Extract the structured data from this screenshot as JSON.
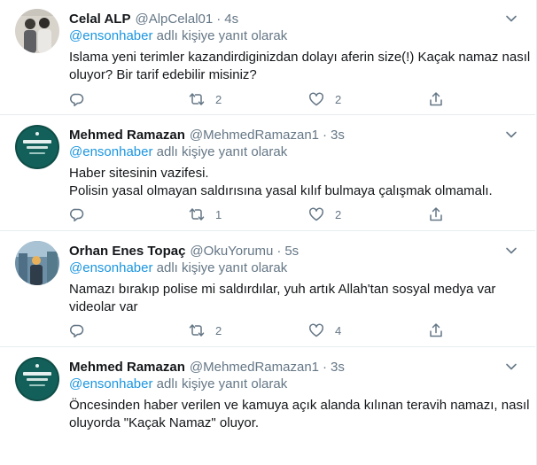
{
  "tweets": [
    {
      "name": "Celal ALP",
      "handle": "@AlpCelal01",
      "time": "4s",
      "reply_prefix": "@ensonhaber",
      "reply_suffix": "adlı kişiye yanıt olarak",
      "lines": [
        "Islama yeni terimler kazandirdiginizdan dolayı aferin size(!) Kaçak namaz nasıl",
        "oluyor? Bir tarif edebilir misiniz?"
      ],
      "reply_count": "",
      "retweet_count": "2",
      "like_count": "2"
    },
    {
      "name": "Mehmed Ramazan",
      "handle": "@MehmedRamazan1",
      "time": "3s",
      "reply_prefix": "@ensonhaber",
      "reply_suffix": "adlı kişiye yanıt olarak",
      "lines": [
        "Haber sitesinin vazifesi.",
        "Polisin yasal olmayan saldırısına yasal kılıf bulmaya çalışmak olmamalı."
      ],
      "reply_count": "",
      "retweet_count": "1",
      "like_count": "2"
    },
    {
      "name": "Orhan Enes Topaç",
      "handle": "@OkuYorumu",
      "time": "5s",
      "reply_prefix": "@ensonhaber",
      "reply_suffix": "adlı kişiye yanıt olarak",
      "lines": [
        "Namazı bırakıp polise mi saldırdılar, yuh artık Allah'tan sosyal medya var",
        "videolar var"
      ],
      "reply_count": "",
      "retweet_count": "2",
      "like_count": "4"
    },
    {
      "name": "Mehmed Ramazan",
      "handle": "@MehmedRamazan1",
      "time": "3s",
      "reply_prefix": "@ensonhaber",
      "reply_suffix": "adlı kişiye yanıt olarak",
      "lines": [
        "Öncesinden haber verilen ve kamuya açık alanda kılınan teravih namazı, nasıl",
        "oluyorda \"Kaçak Namaz\" oluyor."
      ],
      "reply_count": "",
      "retweet_count": "",
      "like_count": ""
    }
  ],
  "colors": {
    "text": "#14171a",
    "secondary": "#657786",
    "link": "#1b95e0",
    "divider": "#e6ecf0"
  },
  "icons": [
    "reply-icon",
    "retweet-icon",
    "like-icon",
    "share-icon",
    "caret-down-icon"
  ]
}
